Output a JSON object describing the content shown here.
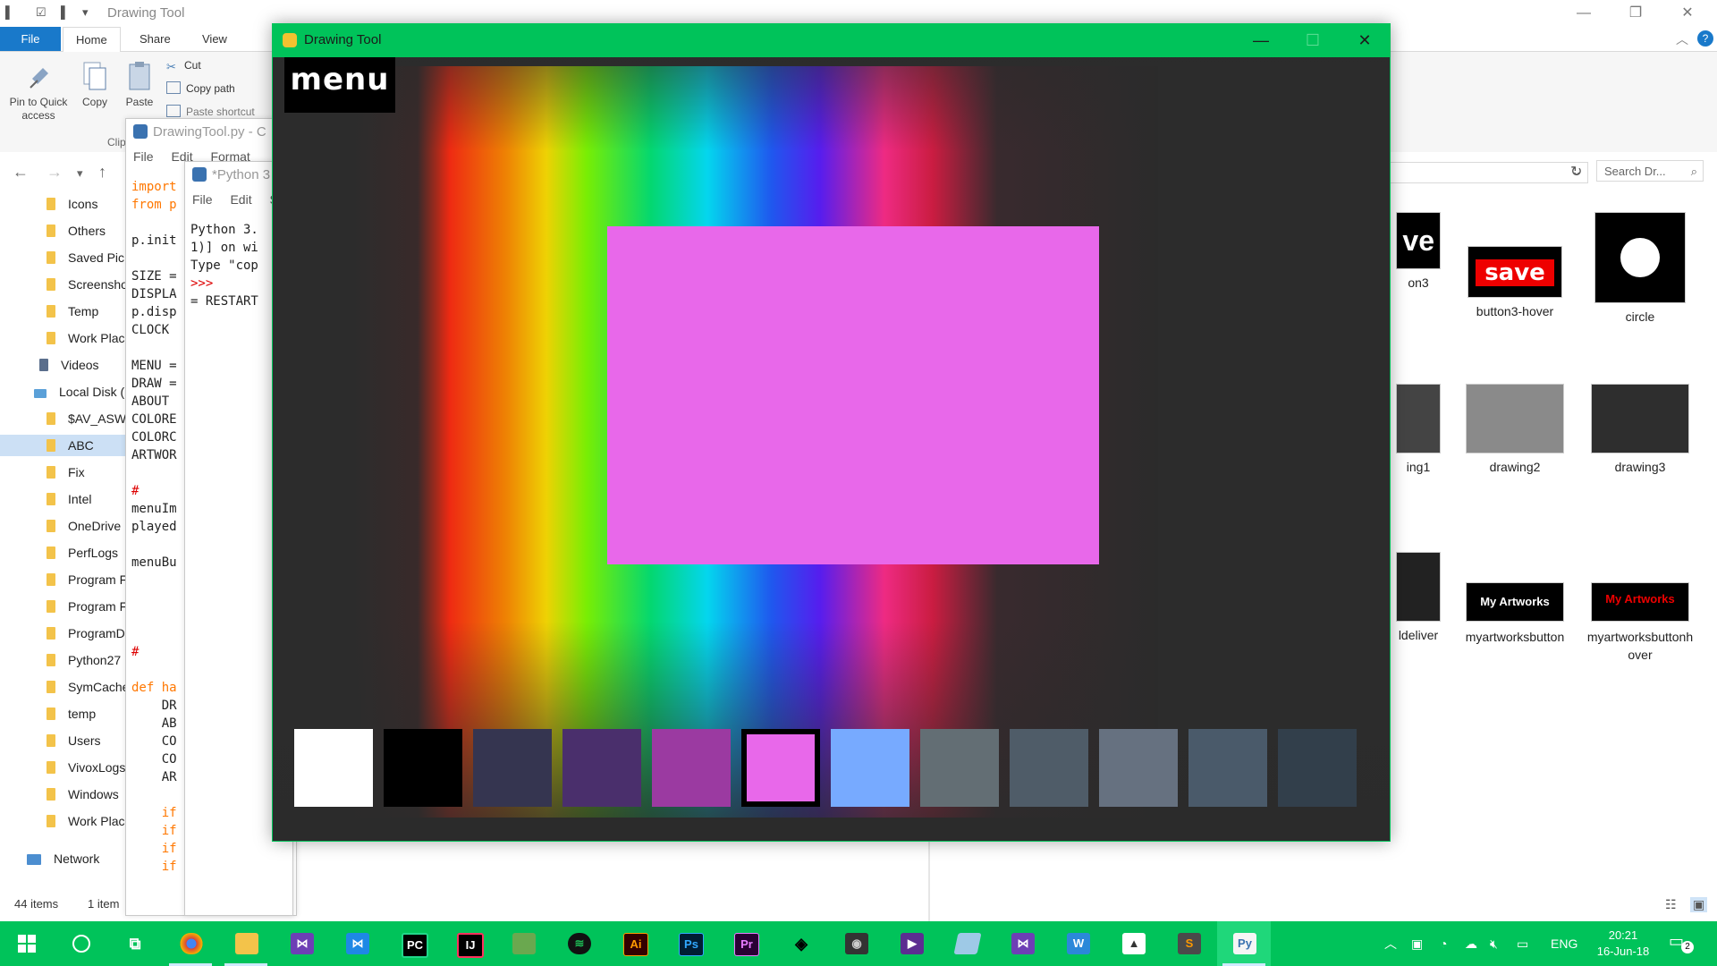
{
  "explorer": {
    "title": "Drawing Tool",
    "tabs": {
      "file": "File",
      "home": "Home",
      "share": "Share",
      "view": "View"
    },
    "ribbon": {
      "pin": "Pin to Quick access",
      "copy": "Copy",
      "paste": "Paste",
      "cut": "Cut",
      "copy_path": "Copy path",
      "paste_shortcut": "Paste shortcut",
      "group_clip": "Clip"
    },
    "search_placeholder": "Search Dr...",
    "tree": [
      "Icons",
      "Others",
      "Saved Pic",
      "Screensho",
      "Temp",
      "Work Plac",
      "Videos",
      "Local Disk (",
      "$AV_ASW",
      "ABC",
      "Fix",
      "Intel",
      "OneDrive",
      "PerfLogs",
      "Program F",
      "Program F",
      "ProgramD",
      "Python27",
      "SymCache",
      "temp",
      "Users",
      "VivoxLogs",
      "Windows",
      "Work Plac",
      "Network"
    ],
    "status_count": "44 items",
    "status_selected": "1 item",
    "files": [
      {
        "label": "on3"
      },
      {
        "label": "button3-hover",
        "thumb_text": "save"
      },
      {
        "label": "circle"
      },
      {
        "label": "ing1"
      },
      {
        "label": "drawing2"
      },
      {
        "label": "drawing3"
      },
      {
        "label": "ldeliver"
      },
      {
        "label": "myartworksbutton",
        "thumb_text": "My Artworks"
      },
      {
        "label": "myartworksbuttonhover",
        "thumb_text": "My Artworks"
      }
    ],
    "partial_thumb_text": "ve"
  },
  "editor_code": {
    "title": "DrawingTool.py - C",
    "menu": [
      "File",
      "Edit",
      "Format"
    ],
    "lines": [
      "import",
      "from p",
      "",
      "p.init",
      "",
      "SIZE =",
      "DISPLA",
      "p.disp",
      "CLOCK",
      "",
      "MENU =",
      "DRAW =",
      "ABOUT",
      "COLORE",
      "COLORC",
      "ARTWOR",
      "",
      "#",
      "menuIm",
      "played",
      "",
      "menuBu",
      "",
      "",
      "",
      "",
      "#",
      "",
      "def ha",
      "    DR",
      "    AB",
      "    CO",
      "    CO",
      "    AR",
      "",
      "    if",
      "    if",
      "    if",
      "    if"
    ]
  },
  "editor_shell": {
    "title": "*Python 3",
    "menu": [
      "File",
      "Edit",
      "S"
    ],
    "lines": [
      "Python 3.",
      "1)] on wi",
      "Type \"cop",
      ">>>",
      "= RESTART"
    ]
  },
  "app": {
    "title": "Drawing Tool",
    "menu_button": "menu",
    "canvas_color": "#e868ea",
    "palette": [
      "#ffffff",
      "#000000",
      "#353550",
      "#4a2f6c",
      "#9b3aa1",
      "#e868ea",
      "#77aaff",
      "#636e74",
      "#4f5c68",
      "#667180",
      "#4a5a6a",
      "#323f4b"
    ],
    "selected_index": 5
  },
  "taskbar": {
    "apps": [
      "windows-start",
      "cortana",
      "task-view",
      "chrome",
      "file-explorer",
      "visual-studio",
      "vscode",
      "pycharm",
      "intellij",
      "minecraft",
      "spotify",
      "illustrator",
      "photoshop",
      "premiere",
      "unity",
      "nvidia",
      "vs-purple",
      "paint",
      "vs-2",
      "wunderlist",
      "photos",
      "sublime",
      "python-idle"
    ],
    "language": "ENG",
    "time": "20:21",
    "date": "16-Jun-18",
    "notifications": "2"
  }
}
